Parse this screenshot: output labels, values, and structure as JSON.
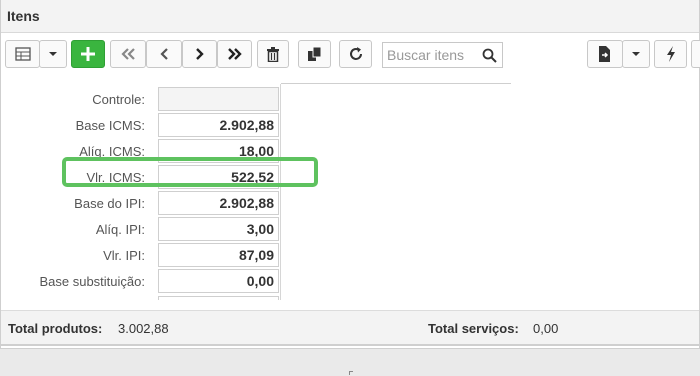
{
  "panel": {
    "title": "Itens"
  },
  "search": {
    "placeholder": "Buscar itens"
  },
  "fields": [
    {
      "label": "Controle:",
      "value": ""
    },
    {
      "label": "Base ICMS:",
      "value": "2.902,88"
    },
    {
      "label": "Alíq. ICMS:",
      "value": "18,00"
    },
    {
      "label": "Vlr. ICMS:",
      "value": "522,52"
    },
    {
      "label": "Base do IPI:",
      "value": "2.902,88"
    },
    {
      "label": "Alíq. IPI:",
      "value": "3,00"
    },
    {
      "label": "Vlr. IPI:",
      "value": "87,09"
    },
    {
      "label": "Base substituição:",
      "value": "0,00"
    }
  ],
  "totals": {
    "produtos_label": "Total produtos:",
    "produtos_value": "3.002,88",
    "servicos_label": "Total serviços:",
    "servicos_value": "0,00"
  },
  "colors": {
    "accent_green": "#3ab53f",
    "highlight": "#5ec25f"
  },
  "icons": [
    "table-icon",
    "chevron-down-icon",
    "plus-icon",
    "first-icon",
    "prev-icon",
    "next-icon",
    "last-icon",
    "trash-icon",
    "copy-icon",
    "refresh-icon",
    "search-icon",
    "export-icon",
    "bolt-icon"
  ]
}
